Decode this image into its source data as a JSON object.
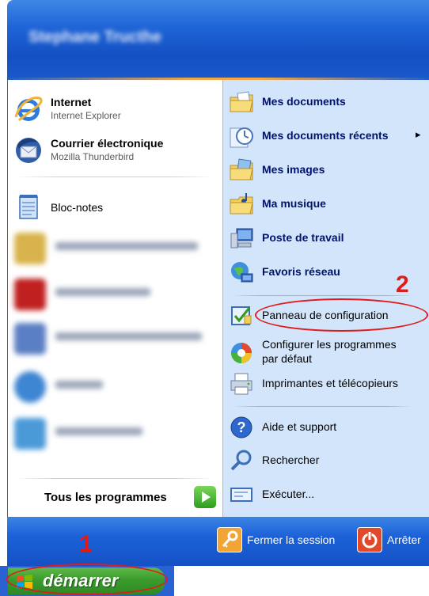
{
  "header": {
    "user_name": "Stephane Tructhe"
  },
  "left": {
    "pinned": [
      {
        "title": "Internet",
        "subtitle": "Internet Explorer",
        "icon": "internet-explorer-icon"
      },
      {
        "title": "Courrier électronique",
        "subtitle": "Mozilla Thunderbird",
        "icon": "thunderbird-icon"
      }
    ],
    "recent_visible": {
      "label": "Bloc-notes",
      "icon": "notepad-icon"
    },
    "all_programs": "Tous les programmes"
  },
  "right": {
    "items": [
      {
        "label": "Mes documents",
        "icon": "my-documents-folder-icon",
        "bold": true
      },
      {
        "label": "Mes documents récents",
        "icon": "recent-documents-icon",
        "bold": true,
        "submenu": "▸"
      },
      {
        "label": "Mes images",
        "icon": "my-pictures-folder-icon",
        "bold": true
      },
      {
        "label": "Ma musique",
        "icon": "my-music-folder-icon",
        "bold": true
      },
      {
        "label": "Poste de travail",
        "icon": "my-computer-icon",
        "bold": true
      },
      {
        "label": "Favoris réseau",
        "icon": "network-places-icon",
        "bold": true
      },
      {
        "label": "Panneau de configuration",
        "icon": "control-panel-icon"
      },
      {
        "label_line1": "Configurer les programmes",
        "label_line2": "par défaut",
        "icon": "default-programs-icon"
      },
      {
        "label": "Imprimantes et télécopieurs",
        "icon": "printers-icon"
      },
      {
        "label": "Aide et support",
        "icon": "help-icon"
      },
      {
        "label": "Rechercher",
        "icon": "search-icon"
      },
      {
        "label": "Exécuter...",
        "icon": "run-icon"
      }
    ]
  },
  "footer": {
    "logoff": "Fermer la session",
    "shutdown": "Arrêter"
  },
  "taskbar": {
    "start_label": "démarrer"
  },
  "annotations": {
    "one": "1",
    "two": "2",
    "color": "#e01b1b"
  }
}
